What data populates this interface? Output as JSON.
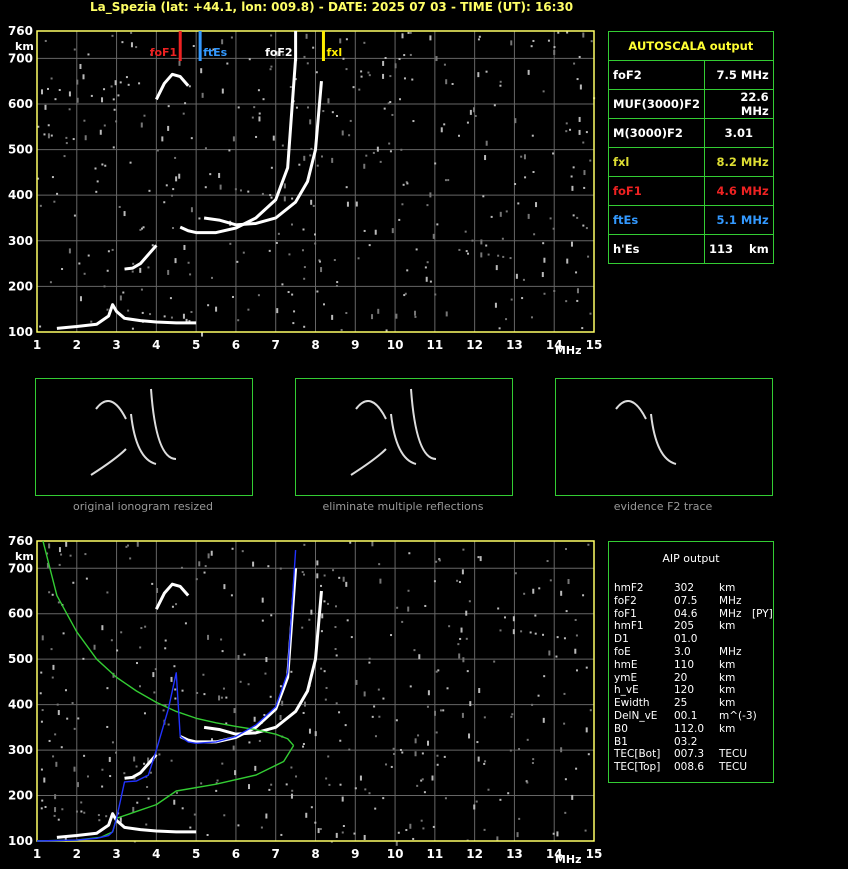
{
  "title": "La_Spezia (lat: +44.1, lon: 009.8) - DATE: 2025 07 03 - TIME (UT): 16:30",
  "colors": {
    "grid": "#666666",
    "axis": "#ffff66",
    "green": "#33cc33",
    "red": "#ee2222",
    "blue": "#3399ff",
    "yellow": "#ffee00",
    "trace": "#ffffff"
  },
  "chart_data": [
    {
      "type": "scatter",
      "title": "",
      "xlabel": "MHz",
      "ylabel": "km",
      "xlim": [
        1,
        15
      ],
      "ylim": [
        100,
        760
      ],
      "xticks": [
        1,
        2,
        3,
        4,
        5,
        6,
        7,
        8,
        9,
        10,
        11,
        12,
        13,
        14,
        15
      ],
      "yticks": [
        100,
        200,
        300,
        400,
        500,
        600,
        700,
        760
      ],
      "grid": true,
      "markers": [
        {
          "label": "foF1",
          "x": 4.6,
          "color": "#ee2222"
        },
        {
          "label": "ftEs",
          "x": 5.1,
          "color": "#3399ff"
        },
        {
          "label": "foF2",
          "x": 7.5,
          "color": "#ffffff"
        },
        {
          "label": "fxl",
          "x": 8.2,
          "color": "#ffee00"
        }
      ],
      "series": [
        {
          "x": [
            1.5,
            2.0,
            2.5,
            2.8,
            2.9,
            3.0,
            3.2,
            3.6,
            4.0,
            4.5,
            5.0
          ],
          "y": [
            108,
            112,
            117,
            135,
            160,
            145,
            130,
            125,
            122,
            120,
            120
          ]
        },
        {
          "x": [
            3.2,
            3.4,
            3.6,
            3.8,
            4.0
          ],
          "y": [
            238,
            240,
            250,
            270,
            290
          ]
        },
        {
          "x": [
            4.0,
            4.2,
            4.4,
            4.6,
            4.8
          ],
          "y": [
            610,
            645,
            665,
            660,
            640
          ]
        },
        {
          "x": [
            4.6,
            4.8,
            5.0,
            5.5,
            6.0,
            6.5,
            7.0,
            7.3,
            7.5
          ],
          "y": [
            330,
            322,
            318,
            318,
            328,
            350,
            390,
            460,
            700
          ]
        },
        {
          "x": [
            5.2,
            5.6,
            6.0,
            6.5,
            7.0,
            7.5,
            7.8,
            8.0,
            8.15
          ],
          "y": [
            350,
            345,
            335,
            338,
            350,
            385,
            430,
            500,
            650
          ]
        }
      ]
    },
    {
      "type": "scatter",
      "title": "",
      "xlabel": "MHz",
      "ylabel": "km",
      "xlim": [
        1,
        15
      ],
      "ylim": [
        100,
        760
      ],
      "xticks": [
        1,
        2,
        3,
        4,
        5,
        6,
        7,
        8,
        9,
        10,
        11,
        12,
        13,
        14,
        15
      ],
      "yticks": [
        100,
        200,
        300,
        400,
        500,
        600,
        700,
        760
      ],
      "grid": true,
      "series": [
        {
          "x": [
            1.5,
            2.0,
            2.5,
            2.8,
            2.9,
            3.0,
            3.2,
            3.6,
            4.0,
            4.5,
            5.0
          ],
          "y": [
            108,
            112,
            117,
            135,
            160,
            145,
            130,
            125,
            122,
            120,
            120
          ]
        },
        {
          "x": [
            3.2,
            3.4,
            3.6,
            3.8,
            4.0
          ],
          "y": [
            238,
            240,
            250,
            270,
            290
          ]
        },
        {
          "x": [
            4.0,
            4.2,
            4.4,
            4.6,
            4.8
          ],
          "y": [
            610,
            645,
            665,
            660,
            640
          ]
        },
        {
          "x": [
            4.6,
            4.8,
            5.0,
            5.5,
            6.0,
            6.5,
            7.0,
            7.3,
            7.5
          ],
          "y": [
            330,
            322,
            318,
            318,
            328,
            350,
            390,
            460,
            700
          ]
        },
        {
          "x": [
            5.2,
            5.6,
            6.0,
            6.5,
            7.0,
            7.5,
            7.8,
            8.0,
            8.15
          ],
          "y": [
            350,
            345,
            335,
            338,
            350,
            385,
            430,
            500,
            650
          ]
        },
        {
          "color": "#33cc33",
          "x": [
            1.15,
            1.5,
            2.0,
            2.5,
            3.0,
            3.5,
            4.0,
            4.5,
            5.0,
            5.5,
            6.0,
            6.5,
            7.0,
            7.3,
            7.45
          ],
          "y": [
            760,
            640,
            560,
            500,
            460,
            430,
            405,
            385,
            370,
            360,
            352,
            345,
            335,
            325,
            310
          ]
        },
        {
          "color": "#33cc33",
          "x": [
            1.0,
            2.0,
            2.6,
            2.9,
            3.0,
            3.5,
            4.0,
            4.5,
            5.5,
            6.5,
            7.2,
            7.45
          ],
          "y": [
            100,
            102,
            108,
            120,
            150,
            165,
            180,
            210,
            225,
            245,
            275,
            310
          ]
        },
        {
          "color": "#2233ff",
          "x": [
            1.0,
            2.0,
            2.5,
            2.8,
            2.9,
            3.0,
            3.2,
            3.5,
            3.8,
            4.0,
            4.3,
            4.5,
            4.6,
            4.8,
            5.0,
            5.5,
            6.0,
            6.5,
            7.0,
            7.3,
            7.5
          ],
          "y": [
            100,
            102,
            106,
            112,
            120,
            150,
            230,
            232,
            245,
            300,
            390,
            470,
            330,
            318,
            315,
            318,
            330,
            355,
            395,
            470,
            740
          ]
        }
      ]
    }
  ],
  "thumbs": [
    {
      "label": "original ionogram resized"
    },
    {
      "label": "eliminate multiple reflections"
    },
    {
      "label": "evidence F2 trace"
    }
  ],
  "autoscala": {
    "header": "AUTOSCALA output",
    "rows": [
      {
        "name": "foF2",
        "value": "7.5 MHz",
        "color": "#ffffff"
      },
      {
        "name": "MUF(3000)F2",
        "value": "22.6 MHz",
        "color": "#ffffff"
      },
      {
        "name": "M(3000)F2",
        "value": "3.01",
        "color": "#ffffff"
      },
      {
        "name": "fxl",
        "value": "8.2 MHz",
        "color": "#dddd33"
      },
      {
        "name": "foF1",
        "value": "4.6 MHz",
        "color": "#ee2222"
      },
      {
        "name": "ftEs",
        "value": "5.1 MHz",
        "color": "#3399ff"
      },
      {
        "name": "h'Es",
        "value": "113",
        "unit": "km",
        "color": "#ffffff"
      }
    ]
  },
  "aip": {
    "header": "AIP output",
    "rows": [
      {
        "name": "hmF2",
        "value": "302",
        "unit": "km"
      },
      {
        "name": "foF2",
        "value": "07.5",
        "unit": "MHz"
      },
      {
        "name": "foF1",
        "value": "04.6",
        "unit": "MHz",
        "extra": "[PY]"
      },
      {
        "name": "hmF1",
        "value": "205",
        "unit": "km"
      },
      {
        "name": "D1",
        "value": "01.0",
        "unit": ""
      },
      {
        "name": "foE",
        "value": "3.0",
        "unit": "MHz"
      },
      {
        "name": "hmE",
        "value": "110",
        "unit": "km"
      },
      {
        "name": "ymE",
        "value": "20",
        "unit": "km"
      },
      {
        "name": "h_vE",
        "value": "120",
        "unit": "km"
      },
      {
        "name": "Ewidth",
        "value": "25",
        "unit": "km"
      },
      {
        "name": "DelN_vE",
        "value": "00.1",
        "unit": "m^(-3)"
      },
      {
        "name": "B0",
        "value": "112.0",
        "unit": "km"
      },
      {
        "name": "B1",
        "value": "03.2",
        "unit": ""
      },
      {
        "name": "TEC[Bot]",
        "value": "007.3",
        "unit": "TECU"
      },
      {
        "name": "TEC[Top]",
        "value": "008.6",
        "unit": "TECU"
      }
    ]
  }
}
